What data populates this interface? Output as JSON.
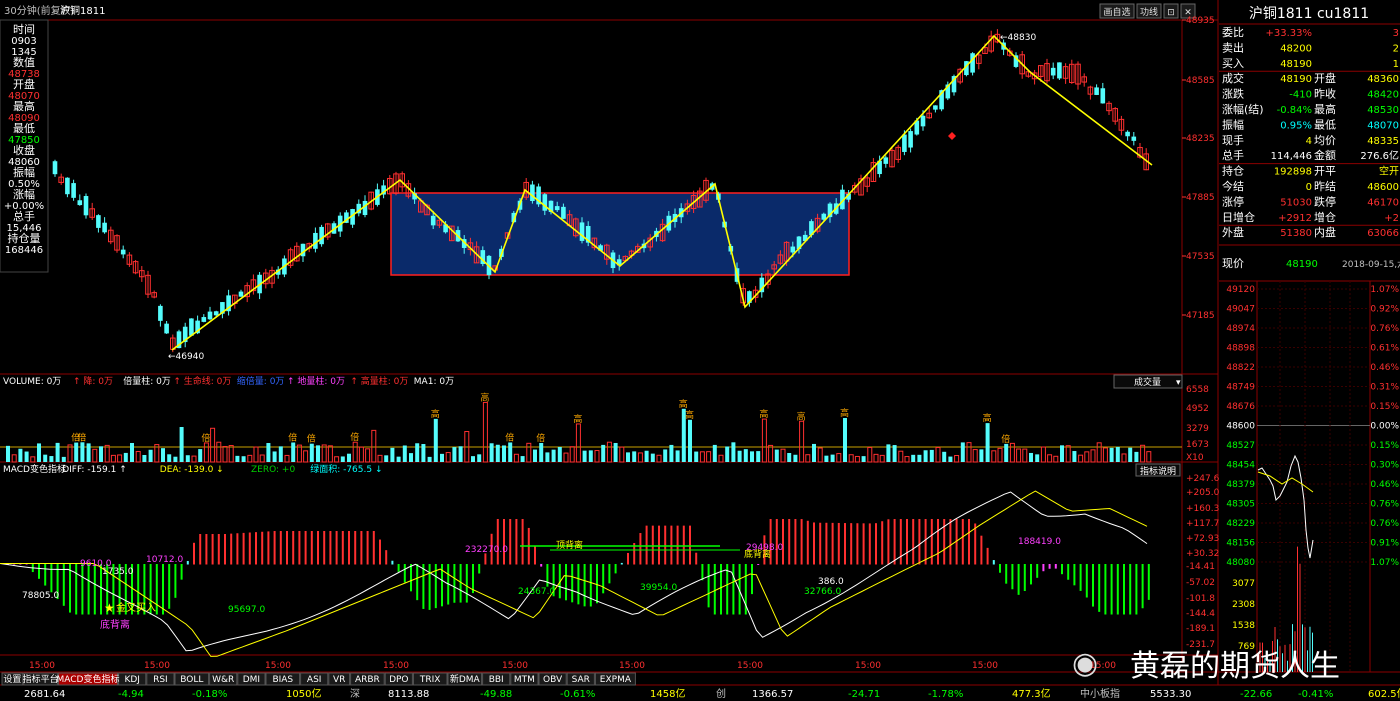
{
  "window": {
    "period_label": "30分钟(前复权)",
    "symbol_short": "沪铜1811",
    "top_buttons": [
      "画自选",
      "功线",
      "⊡",
      "✕"
    ]
  },
  "left_info": [
    {
      "label": "时间",
      "value": "0903"
    },
    {
      "label": "",
      "value": "1345"
    },
    {
      "label": "数值",
      "value": "48738"
    },
    {
      "label": "开盘",
      "value": "48070"
    },
    {
      "label": "最高",
      "value": "48090"
    },
    {
      "label": "最低",
      "value": "47850"
    },
    {
      "label": "收盘",
      "value": "48060"
    },
    {
      "label": "振幅",
      "value": "0.50%"
    },
    {
      "label": "涨幅",
      "value": "+0.00%"
    },
    {
      "label": "总手",
      "value": "15,446"
    },
    {
      "label": "持仓量",
      "value": "168446"
    }
  ],
  "price_axis": [
    "48935",
    "48585",
    "48235",
    "47885",
    "47535",
    "47185"
  ],
  "annotations": {
    "high": "48830",
    "low": "46940"
  },
  "volume_panel": {
    "legend": [
      {
        "text": "VOLUME: 0万",
        "color": "#ffffff"
      },
      {
        "text": "↑ 降: 0万",
        "color": "#ff3030"
      },
      {
        "text": "倍量柱: 0万",
        "color": "#ffffff"
      },
      {
        "text": "↑ 生命线: 0万",
        "color": "#ff3030"
      },
      {
        "text": "缩倍量: 0万",
        "color": "#3366ff"
      },
      {
        "text": "↑ 地量柱: 0万",
        "color": "#ff40ff"
      },
      {
        "text": "↑ 高量柱: 0万",
        "color": "#ff3030"
      },
      {
        "text": "MA1: 0万",
        "color": "#ffffff"
      }
    ],
    "dropdown": "成交量",
    "axis": [
      "6558",
      "4952",
      "3279",
      "1673",
      "X10"
    ],
    "mark_gao": "高",
    "mark_bei": "倍"
  },
  "macd_panel": {
    "legend": [
      {
        "text": "MACD变色指标",
        "color": "#ffffff"
      },
      {
        "text": "DIFF: -159.1 ↑",
        "color": "#ffffff"
      },
      {
        "text": "DEA: -139.0 ↓",
        "color": "#ffff00"
      },
      {
        "text": "ZERO: +0",
        "color": "#00cc00"
      },
      {
        "text": "绿面积: -765.5 ↓",
        "color": "#00ffff"
      }
    ],
    "explain_button": "指标说明",
    "axis": [
      "+247.6",
      "+205.0",
      "+160.3",
      "+117.7",
      "+72.93",
      "+30.32",
      "-14.41",
      "-57.02",
      "-101.8",
      "-144.4",
      "-189.1",
      "-231.7"
    ],
    "labels": [
      "78805.0",
      "9610.0",
      "1735.0",
      "10712.0",
      "95697.0",
      "24367.0",
      "39954.0",
      "32766.0",
      "386.0",
      "188419.0",
      "232270.0",
      "29498.0"
    ],
    "gold_cross": "金叉买入",
    "bottom_div": "底背离",
    "top_div": "顶背离"
  },
  "time_axis": [
    "15:00",
    "15:00",
    "15:00",
    "15:00",
    "15:00",
    "15:00",
    "15:00",
    "15:00",
    "15:00",
    "15:00"
  ],
  "right_panel": {
    "title": "沪铜1811 cu1811",
    "rows": [
      {
        "label": "委比",
        "value": "+33.33%",
        "label2": "",
        "value2": "3",
        "vcolor": "#ff3030"
      },
      {
        "label": "卖出",
        "value": "48200",
        "label2": "",
        "value2": "2",
        "vcolor": "#ffff00"
      },
      {
        "label": "买入",
        "value": "48190",
        "label2": "",
        "value2": "1",
        "vcolor": "#ffff00"
      },
      {
        "label": "成交",
        "value": "48190",
        "label2": "开盘",
        "value2": "48360",
        "vcolor": "#ffff00"
      },
      {
        "label": "涨跌",
        "value": "-410",
        "label2": "昨收",
        "value2": "48420",
        "vcolor": "#00ff00"
      },
      {
        "label": "涨幅(结)",
        "value": "-0.84%",
        "label2": "最高",
        "value2": "48530",
        "vcolor": "#00ff00"
      },
      {
        "label": "振幅",
        "value": "0.95%",
        "label2": "最低",
        "value2": "48070",
        "vcolor": "#00ffff"
      },
      {
        "label": "现手",
        "value": "4",
        "label2": "均价",
        "value2": "48335",
        "vcolor": "#ffff00"
      },
      {
        "label": "总手",
        "value": "114,446",
        "label2": "金额",
        "value2": "276.6亿",
        "vcolor": "#ffffff"
      },
      {
        "label": "持仓",
        "value": "192898",
        "label2": "开平",
        "value2": "空开",
        "vcolor": "#ffff00"
      },
      {
        "label": "今结",
        "value": "0",
        "label2": "昨结",
        "value2": "48600",
        "vcolor": "#ffff00"
      },
      {
        "label": "涨停",
        "value": "51030",
        "label2": "跌停",
        "value2": "46170",
        "vcolor": "#ff3030"
      },
      {
        "label": "日增仓",
        "value": "+2912",
        "label2": "增仓",
        "value2": "+2",
        "vcolor": "#ff3030"
      },
      {
        "label": "外盘",
        "value": "51380",
        "label2": "内盘",
        "value2": "63066",
        "vcolor": "#ff3030"
      }
    ],
    "price_row": {
      "label": "现价",
      "value": "48190",
      "date": "2018-09-15,六"
    },
    "mini_axis_left": [
      "49120",
      "49047",
      "48974",
      "48898",
      "48822",
      "48749",
      "48676",
      "48600",
      "48527",
      "48454",
      "48379",
      "48305",
      "48229",
      "48156",
      "48080",
      "3077",
      "2308",
      "1538",
      "769"
    ],
    "mini_axis_right": [
      "1.07%",
      "0.92%",
      "0.76%",
      "0.61%",
      "0.46%",
      "0.31%",
      "0.15%",
      "0.00%",
      "0.15%",
      "0.30%",
      "0.46%",
      "0.76%",
      "0.76%",
      "0.91%",
      "1.07%"
    ]
  },
  "bottom_tabs": [
    "设置",
    "指标平台",
    "MACD变色指标",
    "KDJ",
    "RSI",
    "BOLL",
    "W&R",
    "DMI",
    "BIAS",
    "ASI",
    "VR",
    "ARBR",
    "DPO",
    "TRIX",
    "新DMA",
    "BBI",
    "MTM",
    "OBV",
    "SAR",
    "EXPMA"
  ],
  "status_bar": [
    {
      "text": "2681.64",
      "color": "#ffffff"
    },
    {
      "text": "-4.94",
      "color": "#00ff00"
    },
    {
      "text": "-0.18%",
      "color": "#00ff00"
    },
    {
      "text": "1050亿",
      "color": "#ffff00"
    },
    {
      "text": "深",
      "color": "#c0c0c0"
    },
    {
      "text": "8113.88",
      "color": "#ffffff"
    },
    {
      "text": "-49.88",
      "color": "#00ff00"
    },
    {
      "text": "-0.61%",
      "color": "#00ff00"
    },
    {
      "text": "1458亿",
      "color": "#ffff00"
    },
    {
      "text": "创",
      "color": "#c0c0c0"
    },
    {
      "text": "1366.57",
      "color": "#ffffff"
    },
    {
      "text": "-24.71",
      "color": "#00ff00"
    },
    {
      "text": "-1.78%",
      "color": "#00ff00"
    },
    {
      "text": "477.3亿",
      "color": "#ffff00"
    },
    {
      "text": "中小板指",
      "color": "#c0c0c0"
    },
    {
      "text": "5533.30",
      "color": "#ffffff"
    },
    {
      "text": "-22.66",
      "color": "#00ff00"
    },
    {
      "text": "-0.41%",
      "color": "#00ff00"
    },
    {
      "text": "602.5亿",
      "color": "#ffff00"
    }
  ],
  "watermark": "黄磊的期货人生",
  "colors": {
    "up": "#ff3030",
    "down": "#54fcfc",
    "zigzag": "#ffff00",
    "box_fill": "#0a2a6a",
    "box_border": "#ff2020",
    "grid": "#8b0000"
  }
}
